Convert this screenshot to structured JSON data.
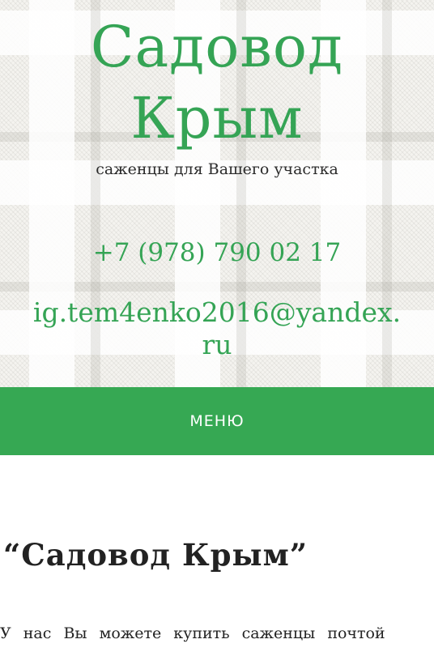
{
  "header": {
    "site_title": "Садовод Крым",
    "tagline": "саженцы для Вашего участка",
    "phone": "+7 (978) 790 02 17",
    "email_line1": "ig.tem4enko2016@yandex.",
    "email_line2": "ru"
  },
  "nav": {
    "menu_label": "МЕНЮ"
  },
  "main": {
    "page_title": "“Садовод Крым”",
    "intro_text": "У нас Вы можете купить саженцы почтой"
  },
  "colors": {
    "brand_green": "#36a853",
    "text_dark": "#222222",
    "background": "#ffffff"
  }
}
